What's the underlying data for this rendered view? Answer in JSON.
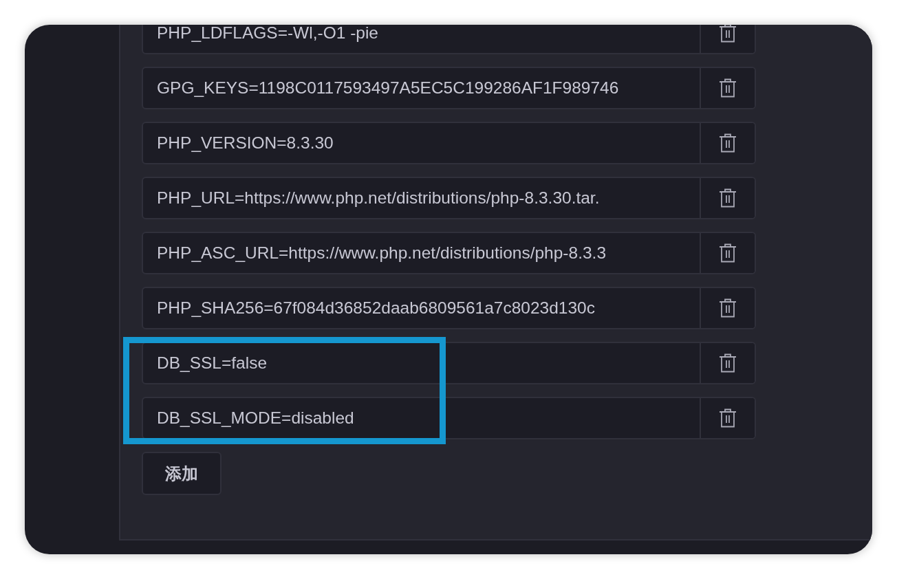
{
  "env_vars": [
    {
      "value": "PHP_LDFLAGS=-Wl,-O1 -pie",
      "highlighted": false
    },
    {
      "value": "GPG_KEYS=1198C0117593497A5EC5C199286AF1F989746",
      "highlighted": false
    },
    {
      "value": "PHP_VERSION=8.3.30",
      "highlighted": false
    },
    {
      "value": "PHP_URL=https://www.php.net/distributions/php-8.3.30.tar.",
      "highlighted": false
    },
    {
      "value": "PHP_ASC_URL=https://www.php.net/distributions/php-8.3.3",
      "highlighted": false
    },
    {
      "value": "PHP_SHA256=67f084d36852daab6809561a7c8023d130c",
      "highlighted": false
    },
    {
      "value": "DB_SSL=false",
      "highlighted": true
    },
    {
      "value": "DB_SSL_MODE=disabled",
      "highlighted": true
    }
  ],
  "add_button": "添加"
}
